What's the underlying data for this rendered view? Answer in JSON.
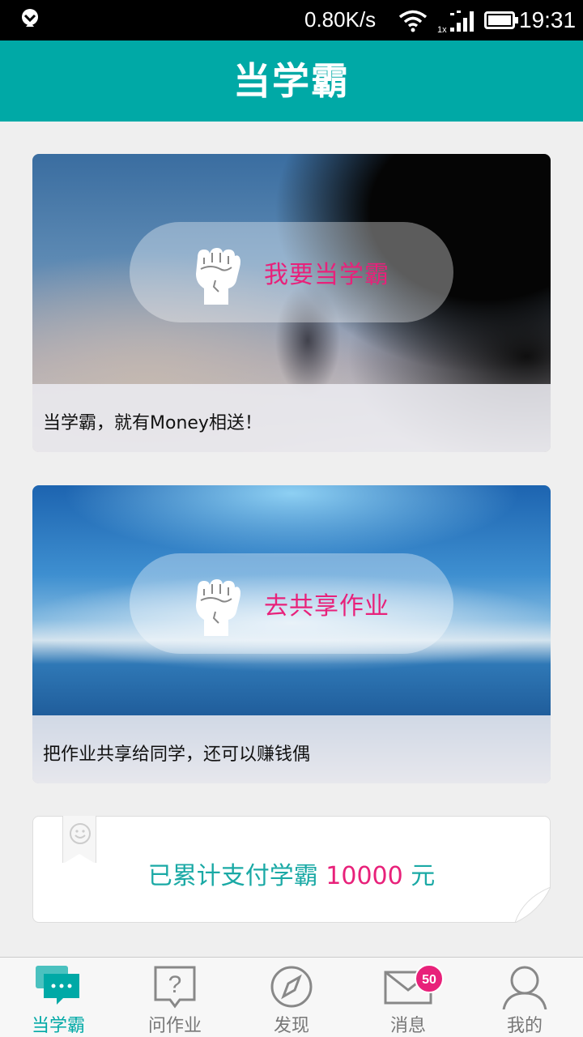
{
  "status_bar": {
    "net_speed": "0.80K/s",
    "time": "19:31",
    "icons": [
      "app-notification-icon",
      "wifi-icon",
      "signal-icon",
      "battery-icon"
    ]
  },
  "header": {
    "title": "当学霸"
  },
  "cards": [
    {
      "button_label": "我要当学霸",
      "caption": "当学霸，就有Money相送！",
      "icon": "fist-icon"
    },
    {
      "button_label": "去共享作业",
      "caption": "把作业共享给同学，还可以赚钱偶",
      "icon": "fist-icon"
    }
  ],
  "stats": {
    "prefix": "已累计支付学霸",
    "amount": "10000",
    "suffix": "元"
  },
  "tabs": [
    {
      "label": "当学霸",
      "icon": "chat-bubble-icon",
      "active": true
    },
    {
      "label": "问作业",
      "icon": "question-bubble-icon",
      "active": false
    },
    {
      "label": "发现",
      "icon": "compass-icon",
      "active": false
    },
    {
      "label": "消息",
      "icon": "envelope-icon",
      "active": false,
      "badge": "50"
    },
    {
      "label": "我的",
      "icon": "user-icon",
      "active": false
    }
  ],
  "colors": {
    "primary": "#00a9a6",
    "accent": "#e8217a"
  }
}
